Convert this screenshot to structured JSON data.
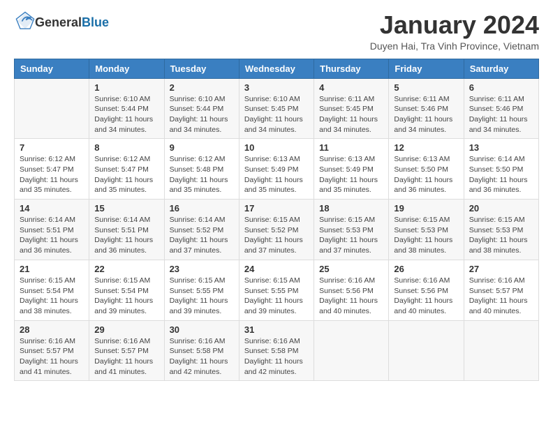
{
  "header": {
    "logo_general": "General",
    "logo_blue": "Blue",
    "month_title": "January 2024",
    "subtitle": "Duyen Hai, Tra Vinh Province, Vietnam"
  },
  "weekdays": [
    "Sunday",
    "Monday",
    "Tuesday",
    "Wednesday",
    "Thursday",
    "Friday",
    "Saturday"
  ],
  "weeks": [
    [
      {
        "day": "",
        "info": ""
      },
      {
        "day": "1",
        "info": "Sunrise: 6:10 AM\nSunset: 5:44 PM\nDaylight: 11 hours\nand 34 minutes."
      },
      {
        "day": "2",
        "info": "Sunrise: 6:10 AM\nSunset: 5:44 PM\nDaylight: 11 hours\nand 34 minutes."
      },
      {
        "day": "3",
        "info": "Sunrise: 6:10 AM\nSunset: 5:45 PM\nDaylight: 11 hours\nand 34 minutes."
      },
      {
        "day": "4",
        "info": "Sunrise: 6:11 AM\nSunset: 5:45 PM\nDaylight: 11 hours\nand 34 minutes."
      },
      {
        "day": "5",
        "info": "Sunrise: 6:11 AM\nSunset: 5:46 PM\nDaylight: 11 hours\nand 34 minutes."
      },
      {
        "day": "6",
        "info": "Sunrise: 6:11 AM\nSunset: 5:46 PM\nDaylight: 11 hours\nand 34 minutes."
      }
    ],
    [
      {
        "day": "7",
        "info": "Sunrise: 6:12 AM\nSunset: 5:47 PM\nDaylight: 11 hours\nand 35 minutes."
      },
      {
        "day": "8",
        "info": "Sunrise: 6:12 AM\nSunset: 5:47 PM\nDaylight: 11 hours\nand 35 minutes."
      },
      {
        "day": "9",
        "info": "Sunrise: 6:12 AM\nSunset: 5:48 PM\nDaylight: 11 hours\nand 35 minutes."
      },
      {
        "day": "10",
        "info": "Sunrise: 6:13 AM\nSunset: 5:49 PM\nDaylight: 11 hours\nand 35 minutes."
      },
      {
        "day": "11",
        "info": "Sunrise: 6:13 AM\nSunset: 5:49 PM\nDaylight: 11 hours\nand 35 minutes."
      },
      {
        "day": "12",
        "info": "Sunrise: 6:13 AM\nSunset: 5:50 PM\nDaylight: 11 hours\nand 36 minutes."
      },
      {
        "day": "13",
        "info": "Sunrise: 6:14 AM\nSunset: 5:50 PM\nDaylight: 11 hours\nand 36 minutes."
      }
    ],
    [
      {
        "day": "14",
        "info": "Sunrise: 6:14 AM\nSunset: 5:51 PM\nDaylight: 11 hours\nand 36 minutes."
      },
      {
        "day": "15",
        "info": "Sunrise: 6:14 AM\nSunset: 5:51 PM\nDaylight: 11 hours\nand 36 minutes."
      },
      {
        "day": "16",
        "info": "Sunrise: 6:14 AM\nSunset: 5:52 PM\nDaylight: 11 hours\nand 37 minutes."
      },
      {
        "day": "17",
        "info": "Sunrise: 6:15 AM\nSunset: 5:52 PM\nDaylight: 11 hours\nand 37 minutes."
      },
      {
        "day": "18",
        "info": "Sunrise: 6:15 AM\nSunset: 5:53 PM\nDaylight: 11 hours\nand 37 minutes."
      },
      {
        "day": "19",
        "info": "Sunrise: 6:15 AM\nSunset: 5:53 PM\nDaylight: 11 hours\nand 38 minutes."
      },
      {
        "day": "20",
        "info": "Sunrise: 6:15 AM\nSunset: 5:53 PM\nDaylight: 11 hours\nand 38 minutes."
      }
    ],
    [
      {
        "day": "21",
        "info": "Sunrise: 6:15 AM\nSunset: 5:54 PM\nDaylight: 11 hours\nand 38 minutes."
      },
      {
        "day": "22",
        "info": "Sunrise: 6:15 AM\nSunset: 5:54 PM\nDaylight: 11 hours\nand 39 minutes."
      },
      {
        "day": "23",
        "info": "Sunrise: 6:15 AM\nSunset: 5:55 PM\nDaylight: 11 hours\nand 39 minutes."
      },
      {
        "day": "24",
        "info": "Sunrise: 6:15 AM\nSunset: 5:55 PM\nDaylight: 11 hours\nand 39 minutes."
      },
      {
        "day": "25",
        "info": "Sunrise: 6:16 AM\nSunset: 5:56 PM\nDaylight: 11 hours\nand 40 minutes."
      },
      {
        "day": "26",
        "info": "Sunrise: 6:16 AM\nSunset: 5:56 PM\nDaylight: 11 hours\nand 40 minutes."
      },
      {
        "day": "27",
        "info": "Sunrise: 6:16 AM\nSunset: 5:57 PM\nDaylight: 11 hours\nand 40 minutes."
      }
    ],
    [
      {
        "day": "28",
        "info": "Sunrise: 6:16 AM\nSunset: 5:57 PM\nDaylight: 11 hours\nand 41 minutes."
      },
      {
        "day": "29",
        "info": "Sunrise: 6:16 AM\nSunset: 5:57 PM\nDaylight: 11 hours\nand 41 minutes."
      },
      {
        "day": "30",
        "info": "Sunrise: 6:16 AM\nSunset: 5:58 PM\nDaylight: 11 hours\nand 42 minutes."
      },
      {
        "day": "31",
        "info": "Sunrise: 6:16 AM\nSunset: 5:58 PM\nDaylight: 11 hours\nand 42 minutes."
      },
      {
        "day": "",
        "info": ""
      },
      {
        "day": "",
        "info": ""
      },
      {
        "day": "",
        "info": ""
      }
    ]
  ]
}
